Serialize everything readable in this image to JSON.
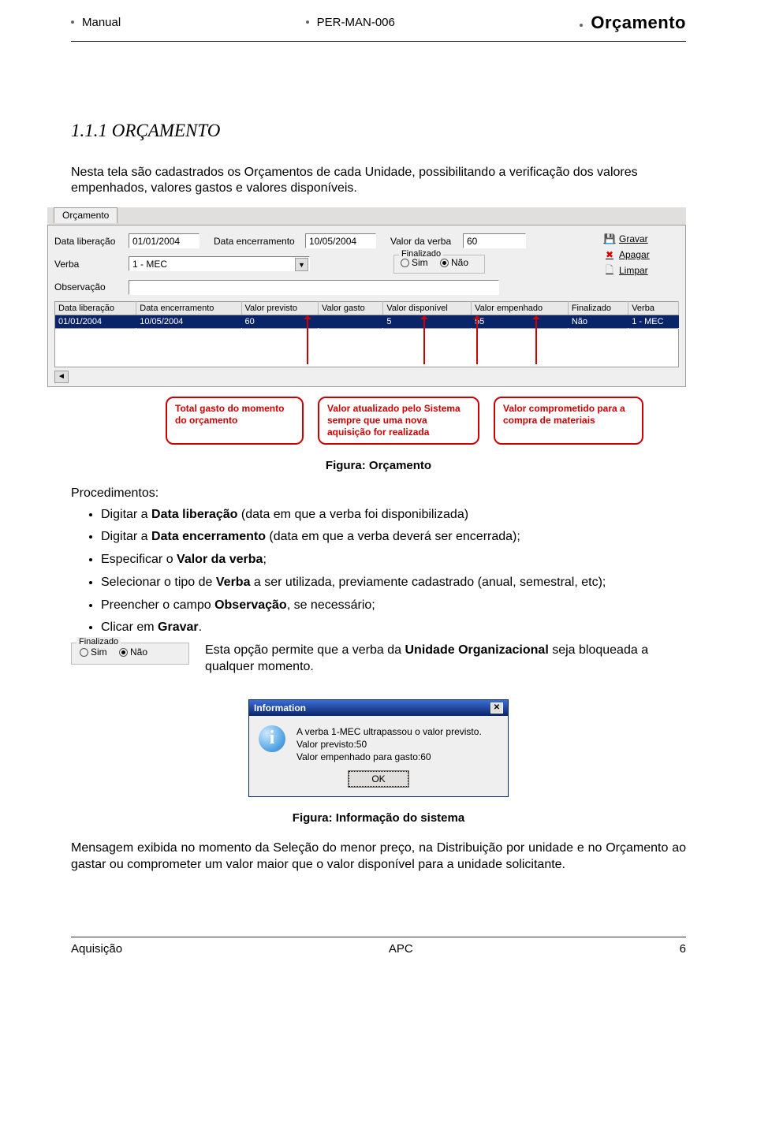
{
  "header": {
    "left": "Manual",
    "mid": "PER-MAN-006",
    "right": "Orçamento"
  },
  "section": {
    "number_title": "1.1.1 ORÇAMENTO",
    "intro": "Nesta tela são cadastrados os Orçamentos de cada Unidade, possibilitando a verificação dos valores empenhados, valores gastos e valores disponíveis."
  },
  "form": {
    "tab": "Orçamento",
    "fields": {
      "data_liberacao_label": "Data liberação",
      "data_liberacao_value": "01/01/2004",
      "data_encerramento_label": "Data encerramento",
      "data_encerramento_value": "10/05/2004",
      "valor_verba_label": "Valor da verba",
      "valor_verba_value": "60",
      "verba_label": "Verba",
      "verba_value": "1 - MEC",
      "observacao_label": "Observação",
      "observacao_value": ""
    },
    "finalizado": {
      "legend": "Finalizado",
      "sim": "Sim",
      "nao": "Não",
      "selected": "nao"
    },
    "buttons": {
      "gravar": "Gravar",
      "apagar": "Apagar",
      "limpar": "Limpar"
    }
  },
  "grid": {
    "headers": [
      "Data liberação",
      "Data encerramento",
      "Valor previsto",
      "Valor gasto",
      "Valor disponível",
      "Valor empenhado",
      "Finalizado",
      "Verba"
    ],
    "row": [
      "01/01/2004",
      "10/05/2004",
      "60",
      "",
      "5",
      "55",
      "Não",
      "1 - MEC"
    ]
  },
  "callout1": "Total gasto do momento do orçamento",
  "callout2": "Valor atualizado pelo Sistema sempre que uma nova aquisição for realizada",
  "callout3": "Valor comprometido para a compra de materiais",
  "figcap1": "Figura: Orçamento",
  "procedimentos": "Procedimentos:",
  "li1a": "Digitar a ",
  "li1b": "Data liberação",
  "li1c": " (data em que a verba foi disponibilizada)",
  "li2a": "Digitar a ",
  "li2b": "Data encerramento",
  "li2c": " (data em que a verba deverá ser encerrada);",
  "li3a": "Especificar o ",
  "li3b": "Valor da verba",
  "li3c": ";",
  "li4a": "Selecionar o tipo de ",
  "li4b": "Verba",
  "li4c": " a ser utilizada, previamente cadastrado (anual, semestral, etc);",
  "li5a": "Preencher o campo ",
  "li5b": "Observação",
  "li5c": ", se necessário;",
  "li6a": "Clicar em ",
  "li6b": "Gravar",
  "li6c": ".",
  "inline_fin_text": "Esta opção permite que a verba da Unidade Organizacional seja bloqueada a qualquer momento.",
  "info_dlg": {
    "title": "Information",
    "line1": "A verba 1-MEC ultrapassou o valor previsto.",
    "line2": "Valor previsto:50",
    "line3": "Valor empenhado para gasto:60",
    "ok": "OK"
  },
  "figcap2": "Figura: Informação do sistema",
  "bottom_para": "Mensagem exibida no momento da Seleção do menor preço, na Distribuição por unidade e no Orçamento ao gastar ou comprometer um valor maior que o valor disponível para a unidade solicitante.",
  "footer": {
    "left": "Aquisição",
    "mid": "APC",
    "right": "6"
  }
}
